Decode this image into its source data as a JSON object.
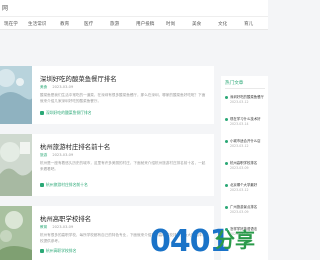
{
  "site": {
    "logo_text": "网"
  },
  "nav": [
    "现在学",
    "生活常识",
    "教育",
    "医疗",
    "旅游",
    "用户投稿",
    "时尚",
    "美食",
    "文化",
    "育儿"
  ],
  "articles": [
    {
      "title": "深圳好吃的酸菜鱼餐厅排名",
      "tag": "美食",
      "date": "2023-03-09",
      "desc": "酸菜鱼是我们生活中常吃的一道菜，在深圳有很多酸菜鱼餐厅，那么在深圳，哪家的酸菜鱼好吃呢？下面就来介绍几家深圳好吃的酸菜鱼餐厅。",
      "link": "深圳好吃的酸菜鱼餐厅排名"
    },
    {
      "title": "杭州旅游村庄排名前十名",
      "tag": "旅游",
      "date": "2023-03-09",
      "desc": "杭州是一座有着悠久历史的城市，这里有许多美丽的村庄，下面就来介绍杭州旅游村庄排名前十名，一起来看看吧。",
      "link": "杭州旅游村庄排名前十名"
    },
    {
      "title": "杭州高职学校排名",
      "tag": "教育",
      "date": "2023-03-09",
      "desc": "杭州有很多的高职学校，每所学校都有自己的特色专业，下面就来介绍杭州高职学校排名，为大家选择学校提供参考。",
      "link": "杭州高职学校排名"
    }
  ],
  "sidebar": {
    "heading": "热门文章",
    "items": [
      {
        "title": "深圳好吃的酸菜鱼餐厅",
        "date": "2023-03-12"
      },
      {
        "title": "现在学习什么技术好",
        "date": "2023-03-14"
      },
      {
        "title": "小城市适合开什么店",
        "date": "2023-03-12"
      },
      {
        "title": "杭州高职学校排名",
        "date": "2023-03-09"
      },
      {
        "title": "北京哪个大学最好",
        "date": "2023-03-12"
      },
      {
        "title": "广州旅游景点排名",
        "date": "2023-03-09"
      },
      {
        "title": "怎样学好英语语法",
        "date": "2023-03-09"
      }
    ]
  },
  "watermark": {
    "text": "0401",
    "sub": "分享"
  }
}
